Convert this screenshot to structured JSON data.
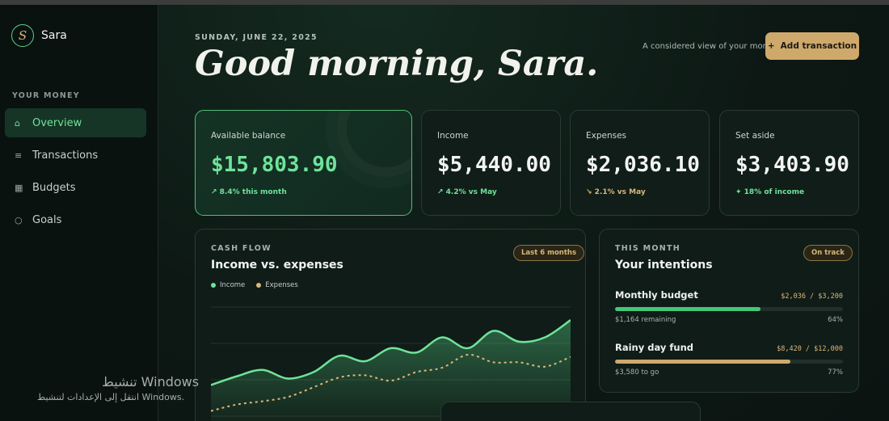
{
  "brand": {
    "logo_letter": "S",
    "name": "Sara"
  },
  "sidebar": {
    "section_label": "YOUR MONEY",
    "items": [
      {
        "label": "Overview",
        "icon": "home-icon",
        "glyph": "⌂",
        "active": true
      },
      {
        "label": "Transactions",
        "icon": "list-icon",
        "glyph": "≡",
        "active": false
      },
      {
        "label": "Budgets",
        "icon": "grid-icon",
        "glyph": "▦",
        "active": false
      },
      {
        "label": "Goals",
        "icon": "circle-icon",
        "glyph": "○",
        "active": false
      }
    ]
  },
  "header": {
    "date": "SUNDAY, JUNE 22, 2025",
    "greeting": "Good morning, Sara.",
    "tagline": "A considered view of your money.",
    "add_button": {
      "icon": "plus-icon",
      "glyph": "+",
      "label": "Add transaction"
    }
  },
  "cards": [
    {
      "label": "Available balance",
      "value": "$15,803.90",
      "delta": "↗ 8.4% this month",
      "tone": "positive"
    },
    {
      "label": "Income",
      "value": "$5,440.00",
      "delta": "↗ 4.2% vs May",
      "tone": "positive"
    },
    {
      "label": "Expenses",
      "value": "$2,036.10",
      "delta": "↘ 2.1% vs May",
      "tone": "warn"
    },
    {
      "label": "Set aside",
      "value": "$3,403.90",
      "delta": "✦ 18% of income",
      "tone": "positive"
    }
  ],
  "cashflow": {
    "eyebrow": "CASH FLOW",
    "title": "Income vs. expenses",
    "period_pill": "Last 6 months",
    "legend": [
      {
        "label": "Income",
        "color": "#6fe39a"
      },
      {
        "label": "Expenses",
        "color": "#d9b77a"
      }
    ]
  },
  "chart_data": {
    "type": "area",
    "series": [
      {
        "name": "Income",
        "color": "#6fe39a",
        "values": [
          0.28,
          0.36,
          0.42,
          0.34,
          0.4,
          0.55,
          0.5,
          0.62,
          0.58,
          0.72,
          0.62,
          0.78,
          0.68,
          0.72,
          0.88
        ]
      },
      {
        "name": "Expenses",
        "color": "#d9b77a",
        "values": [
          0.04,
          0.1,
          0.13,
          0.17,
          0.26,
          0.35,
          0.37,
          0.32,
          0.4,
          0.44,
          0.56,
          0.49,
          0.49,
          0.45,
          0.54
        ]
      }
    ]
  },
  "intentions": {
    "eyebrow": "THIS MONTH",
    "title": "Your intentions",
    "status_pill": "On track",
    "goals": [
      {
        "name": "Monthly budget",
        "amount": "$2,036 / $3,200",
        "remaining": "$1,164 remaining",
        "percent_label": "64%",
        "progress": 0.64,
        "color": "#43c77a"
      },
      {
        "name": "Rainy day fund",
        "amount": "$8,420 / $12,000",
        "remaining": "$3,580 to go",
        "percent_label": "77%",
        "progress": 0.77,
        "color": "#cfa96b"
      }
    ]
  },
  "watermark": {
    "title": "تنشيط Windows",
    "subtitle": "انتقل إلى الإعدادات لتنشيط Windows."
  }
}
